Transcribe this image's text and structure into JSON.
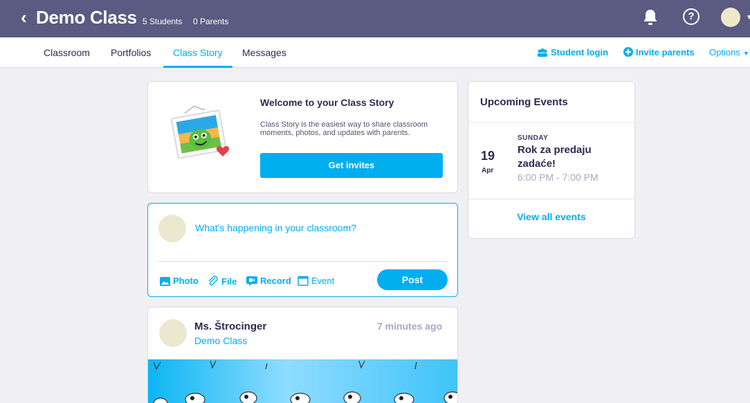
{
  "header": {
    "back_glyph": "‹",
    "class_title": "Demo Class",
    "students": "5 Students",
    "parents": "0 Parents",
    "help_glyph": "?"
  },
  "tabs": [
    {
      "label": "Classroom"
    },
    {
      "label": "Portfolios"
    },
    {
      "label": "Class Story",
      "active": true
    },
    {
      "label": "Messages"
    }
  ],
  "right_actions": {
    "student_login": "Student login",
    "invite_parents": "Invite parents",
    "options": "Options"
  },
  "welcome": {
    "title": "Welcome to your Class Story",
    "description": "Class Story is the easiest way to share classroom moments, photos, and updates with parents.",
    "button": "Get invites"
  },
  "composer": {
    "placeholder": "What's happening in your classroom?",
    "actions": {
      "photo": "Photo",
      "file": "File",
      "record": "Record",
      "event": "Event"
    },
    "post_button": "Post"
  },
  "post": {
    "author": "Ms. Štrocinger",
    "class_name": "Demo Class",
    "time": "7 minutes ago"
  },
  "events": {
    "title": "Upcoming Events",
    "items": [
      {
        "day": "19",
        "month": "Apr",
        "weekday": "SUNDAY",
        "name": "Rok za predaju zadaće!",
        "time": "6:00 PM - 7:00 PM"
      }
    ],
    "view_all": "View all events"
  },
  "colors": {
    "header_bg": "#5a5a82",
    "accent": "#00aef0",
    "page_bg": "#f0f0f4",
    "text_dark": "#2c2a50",
    "muted": "#a9a8c2"
  }
}
